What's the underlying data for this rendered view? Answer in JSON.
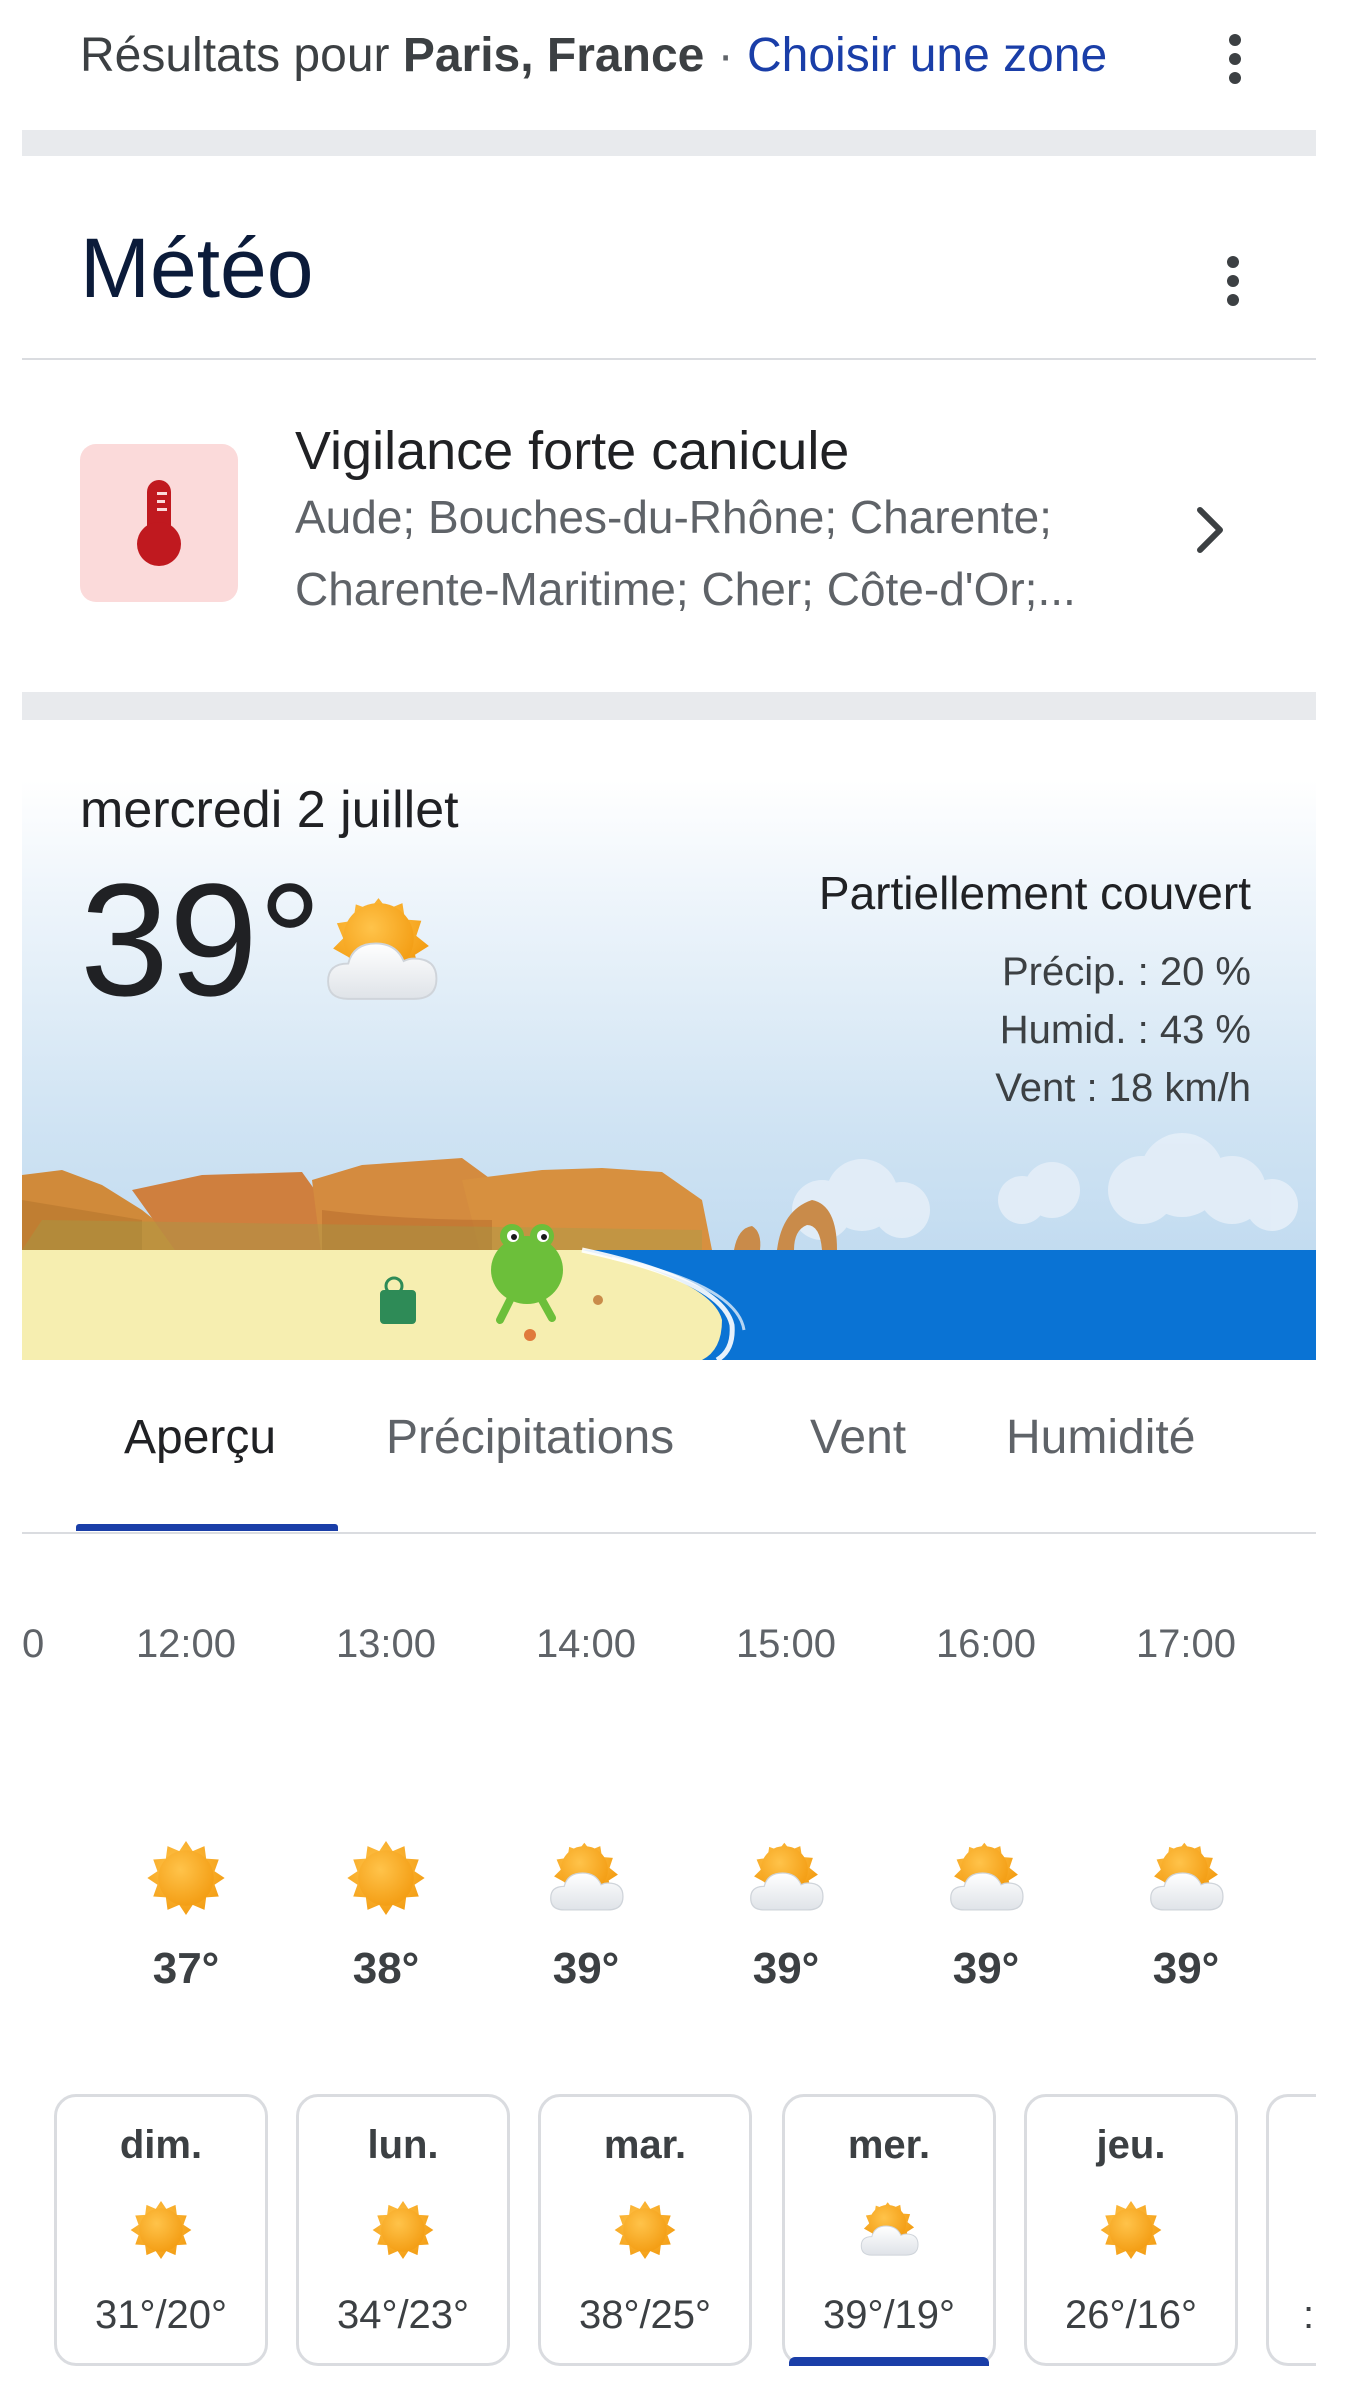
{
  "location_bar": {
    "prefix": "Résultats pour ",
    "place": "Paris, France",
    "separator": " · ",
    "link": "Choisir une zone"
  },
  "card": {
    "title": "Météo"
  },
  "alert": {
    "title": "Vigilance forte canicule",
    "line1": "Aude; Bouches-du-Rhône; Charente;",
    "line2": "Charente-Maritime; Cher; Côte-d'Or;...",
    "icon": "thermometer-icon"
  },
  "current": {
    "date": "mercredi 2 juillet",
    "temp": "39°",
    "condition": "Partiellement couvert",
    "precip": "Précip. : 20 %",
    "humidity": "Humid. : 43 %",
    "wind": "Vent : 18 km/h"
  },
  "tabs": [
    {
      "label": "Aperçu",
      "active": true
    },
    {
      "label": "Précipitations",
      "active": false
    },
    {
      "label": "Vent",
      "active": false
    },
    {
      "label": "Humidité",
      "active": false
    }
  ],
  "hourly": [
    {
      "time": "12:00",
      "icon": "sun-icon",
      "temp": "37°"
    },
    {
      "time": "13:00",
      "icon": "sun-icon",
      "temp": "38°"
    },
    {
      "time": "14:00",
      "icon": "partly-cloudy-icon",
      "temp": "39°"
    },
    {
      "time": "15:00",
      "icon": "partly-cloudy-icon",
      "temp": "39°"
    },
    {
      "time": "16:00",
      "icon": "partly-cloudy-icon",
      "temp": "39°"
    },
    {
      "time": "17:00",
      "icon": "partly-cloudy-icon",
      "temp": "39°"
    }
  ],
  "daily": [
    {
      "day": "dim.",
      "icon": "sun-icon",
      "temps": "31°/20°"
    },
    {
      "day": "lun.",
      "icon": "sun-icon",
      "temps": "34°/23°"
    },
    {
      "day": "mar.",
      "icon": "sun-icon",
      "temps": "38°/25°"
    },
    {
      "day": "mer.",
      "icon": "partly-cloudy-icon",
      "temps": "39°/19°",
      "selected": true
    },
    {
      "day": "jeu.",
      "icon": "sun-icon",
      "temps": "26°/16°"
    }
  ],
  "colors": {
    "accent": "#1a3ea8",
    "sun": "#f9a825",
    "sea": "#0a73d4",
    "alert_bg": "#fbdada",
    "alert_icon": "#c0191f"
  }
}
